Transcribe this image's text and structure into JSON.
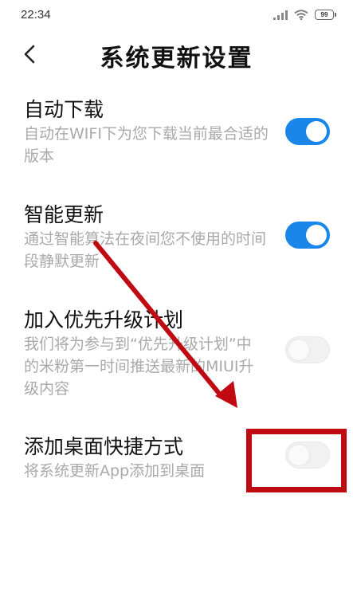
{
  "status_bar": {
    "time": "22:34",
    "battery": "99"
  },
  "header": {
    "title": "系统更新设置"
  },
  "settings": [
    {
      "title": "自动下载",
      "desc": "自动在WIFI下为您下载当前最合适的版本",
      "enabled": true
    },
    {
      "title": "智能更新",
      "desc": "通过智能算法在夜间您不使用的时间段静默更新",
      "enabled": true
    },
    {
      "title": "加入优先升级计划",
      "desc": "我们将为参与到“优先升级计划”中的米粉第一时间推送最新的MIUI升级内容",
      "enabled": false
    },
    {
      "title": "添加桌面快捷方式",
      "desc": "将系统更新App添加到桌面",
      "enabled": false
    }
  ],
  "colors": {
    "accent": "#1a86ea",
    "annotation": "#c00a12",
    "secondary_text": "#a9a9a9"
  },
  "icons": {
    "back": "chevron-left-icon",
    "signal": "signal-icon",
    "wifi": "wifi-icon",
    "battery": "battery-icon"
  }
}
